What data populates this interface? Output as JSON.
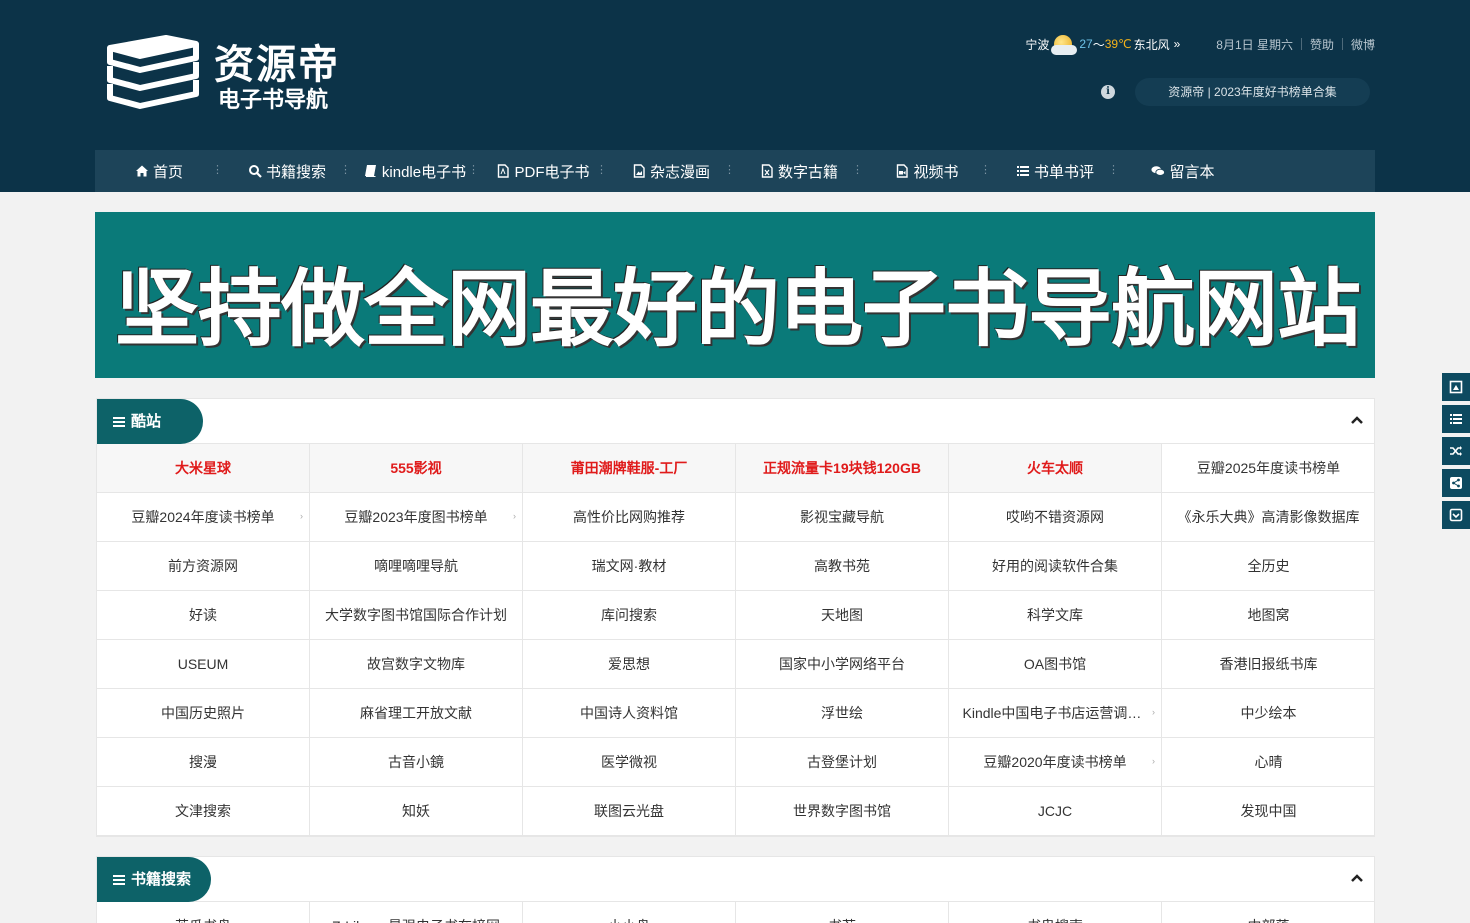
{
  "logo": {
    "title": "资源帝",
    "subtitle": "电子书导航"
  },
  "weather": {
    "city": "宁波",
    "temp_low": "27",
    "separator": "～",
    "temp_high": "39℃",
    "wind": "东北风",
    "more": "»"
  },
  "top_meta": {
    "date": "8月1日 星期六",
    "sponsor": "赞助",
    "weibo": "微博"
  },
  "notice": {
    "icon": "info-icon",
    "text": "资源帝 | 2023年度好书榜单合集"
  },
  "nav": [
    {
      "label": "首页",
      "icon": "home-icon"
    },
    {
      "label": "书籍搜索",
      "icon": "search-icon"
    },
    {
      "label": "kindle电子书",
      "icon": "book-icon"
    },
    {
      "label": "PDF电子书",
      "icon": "pdf-icon"
    },
    {
      "label": "杂志漫画",
      "icon": "image-icon"
    },
    {
      "label": "数字古籍",
      "icon": "archive-icon"
    },
    {
      "label": "视频书",
      "icon": "video-icon"
    },
    {
      "label": "书单书评",
      "icon": "list-icon"
    },
    {
      "label": "留言本",
      "icon": "comments-icon"
    }
  ],
  "banner": {
    "text": "坚持做全网最好的电子书导航网站"
  },
  "sections": [
    {
      "title": "酷站",
      "items": [
        {
          "label": "大米星球",
          "hot": true
        },
        {
          "label": "555影视",
          "hot": true
        },
        {
          "label": "莆田潮牌鞋服-工厂",
          "hot": true
        },
        {
          "label": "正规流量卡19块钱120GB",
          "hot": true
        },
        {
          "label": "火车太顺",
          "hot": true
        },
        {
          "label": "豆瓣2025年度读书榜单"
        },
        {
          "label": "豆瓣2024年度读书榜单",
          "arrow": true
        },
        {
          "label": "豆瓣2023年度图书榜单",
          "arrow": true
        },
        {
          "label": "高性价比网购推荐"
        },
        {
          "label": "影视宝藏导航"
        },
        {
          "label": "哎哟不错资源网"
        },
        {
          "label": "《永乐大典》高清影像数据库"
        },
        {
          "label": "前方资源网"
        },
        {
          "label": "嘀哩嘀哩导航"
        },
        {
          "label": "瑞文网·教材"
        },
        {
          "label": "高教书苑"
        },
        {
          "label": "好用的阅读软件合集"
        },
        {
          "label": "全历史"
        },
        {
          "label": "好读"
        },
        {
          "label": "大学数字图书馆国际合作计划"
        },
        {
          "label": "库问搜索"
        },
        {
          "label": "天地图"
        },
        {
          "label": "科学文库"
        },
        {
          "label": "地图窝"
        },
        {
          "label": "USEUM"
        },
        {
          "label": "故宫数字文物库"
        },
        {
          "label": "爱思想"
        },
        {
          "label": "国家中小学网络平台"
        },
        {
          "label": "OA图书馆"
        },
        {
          "label": "香港旧报纸书库"
        },
        {
          "label": "中国历史照片"
        },
        {
          "label": "麻省理工开放文献"
        },
        {
          "label": "中国诗人资料馆"
        },
        {
          "label": "浮世绘"
        },
        {
          "label": "Kindle中国电子书店运营调整通知",
          "arrow": true
        },
        {
          "label": "中少绘本"
        },
        {
          "label": "搜漫"
        },
        {
          "label": "古音小鏡"
        },
        {
          "label": "医学微视"
        },
        {
          "label": "古登堡计划"
        },
        {
          "label": "豆瓣2020年度读书榜单",
          "arrow": true
        },
        {
          "label": "心晴"
        },
        {
          "label": "文津搜索"
        },
        {
          "label": "知妖"
        },
        {
          "label": "联图云光盘"
        },
        {
          "label": "世界数字图书馆"
        },
        {
          "label": "JCJC"
        },
        {
          "label": "发现中国"
        }
      ]
    },
    {
      "title": "书籍搜索",
      "items": [
        {
          "label": "苦瓜书盘"
        },
        {
          "label": "Z-Library最强电子书在榜网"
        },
        {
          "label": "小小盘"
        },
        {
          "label": "书荐"
        },
        {
          "label": "书鬼搜索"
        },
        {
          "label": "中部落"
        }
      ]
    }
  ],
  "side_tools": [
    "portrait-icon",
    "list-icon",
    "random-icon",
    "share-icon",
    "save-icon"
  ]
}
